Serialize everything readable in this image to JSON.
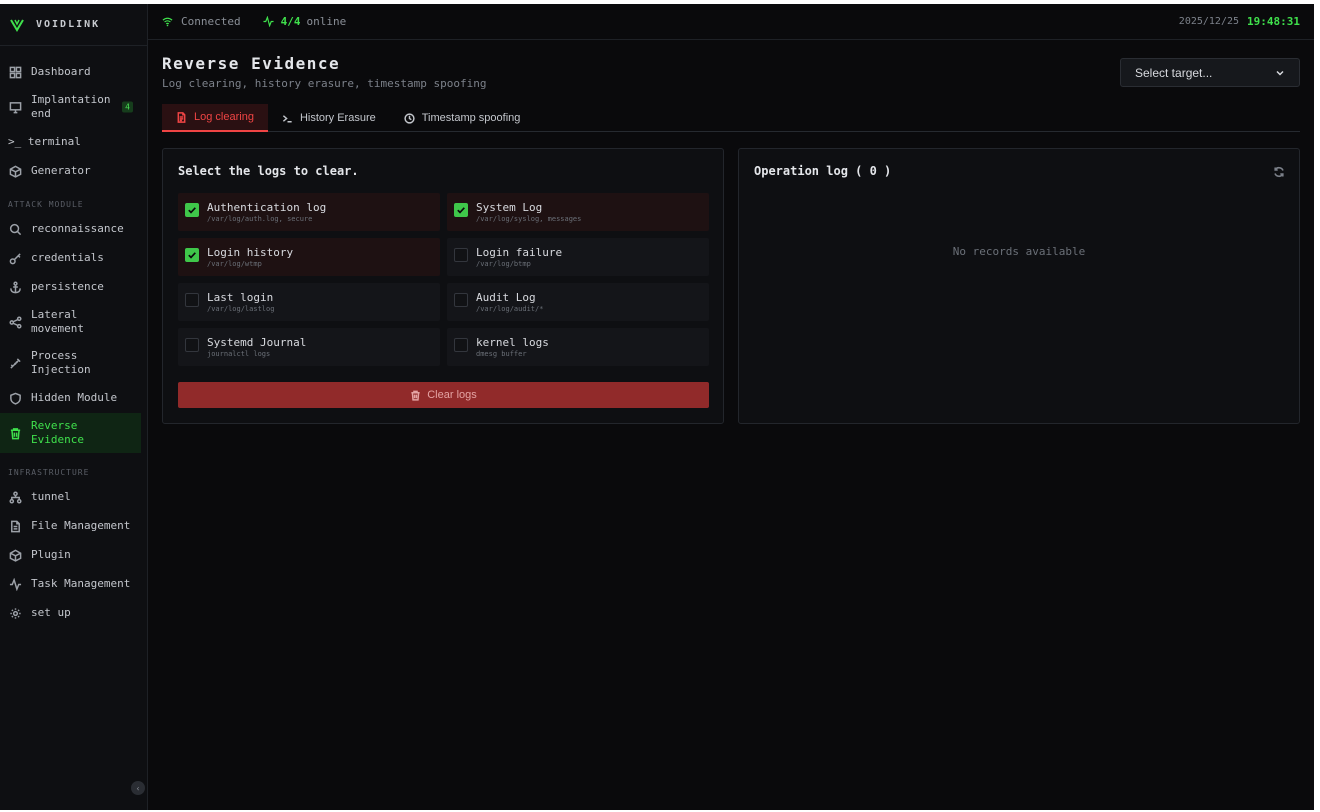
{
  "brand": {
    "name": "VOIDLINK",
    "accent": "#3fe04c"
  },
  "topbar": {
    "connection": "Connected",
    "online_count": "4/4",
    "online_label": "online",
    "date": "2025/12/25",
    "time": "19:48:31"
  },
  "sidebar": {
    "main": [
      {
        "label": "Dashboard",
        "icon": "dashboard-icon"
      },
      {
        "label": "Implantation end",
        "icon": "monitor-icon",
        "badge": "4"
      },
      {
        "label": ">_ terminal",
        "icon": "terminal-icon"
      },
      {
        "label": "Generator",
        "icon": "box-icon"
      }
    ],
    "attack_label": "ATTACK MODULE",
    "attack": [
      {
        "label": "reconnaissance",
        "icon": "search-icon"
      },
      {
        "label": "credentials",
        "icon": "key-icon"
      },
      {
        "label": "persistence",
        "icon": "anchor-icon"
      },
      {
        "label": "Lateral movement",
        "icon": "share-icon"
      },
      {
        "label": "Process Injection",
        "icon": "syringe-icon"
      },
      {
        "label": "Hidden Module",
        "icon": "shield-icon"
      },
      {
        "label": "Reverse Evidence",
        "icon": "trash-icon"
      }
    ],
    "infra_label": "INFRASTRUCTURE",
    "infra": [
      {
        "label": "tunnel",
        "icon": "network-icon"
      },
      {
        "label": "File Management",
        "icon": "file-icon"
      },
      {
        "label": "Plugin",
        "icon": "package-icon"
      },
      {
        "label": "Task Management",
        "icon": "activity-icon"
      },
      {
        "label": "set up",
        "icon": "gear-icon"
      }
    ],
    "collapse_glyph": "‹"
  },
  "page": {
    "title": "Reverse Evidence",
    "subtitle": "Log clearing, history erasure, timestamp spoofing",
    "target_placeholder": "Select target..."
  },
  "tabs": [
    {
      "label": "Log clearing",
      "active": true
    },
    {
      "label": "History Erasure",
      "active": false
    },
    {
      "label": "Timestamp spoofing",
      "active": false
    }
  ],
  "logs_panel": {
    "title": "Select the logs to clear.",
    "items": [
      {
        "name": "Authentication log",
        "path": "/var/log/auth.log, secure",
        "checked": true
      },
      {
        "name": "System Log",
        "path": "/var/log/syslog, messages",
        "checked": true
      },
      {
        "name": "Login history",
        "path": "/var/log/wtmp",
        "checked": true
      },
      {
        "name": "Login failure",
        "path": "/var/log/btmp",
        "checked": false
      },
      {
        "name": "Last login",
        "path": "/var/log/lastlog",
        "checked": false
      },
      {
        "name": "Audit Log",
        "path": "/var/log/audit/*",
        "checked": false
      },
      {
        "name": "Systemd Journal",
        "path": "journalctl logs",
        "checked": false
      },
      {
        "name": "kernel logs",
        "path": "dmesg buffer",
        "checked": false
      }
    ],
    "clear_button": "Clear logs"
  },
  "operation_panel": {
    "title": "Operation log ( 0 )",
    "empty": "No records available"
  }
}
